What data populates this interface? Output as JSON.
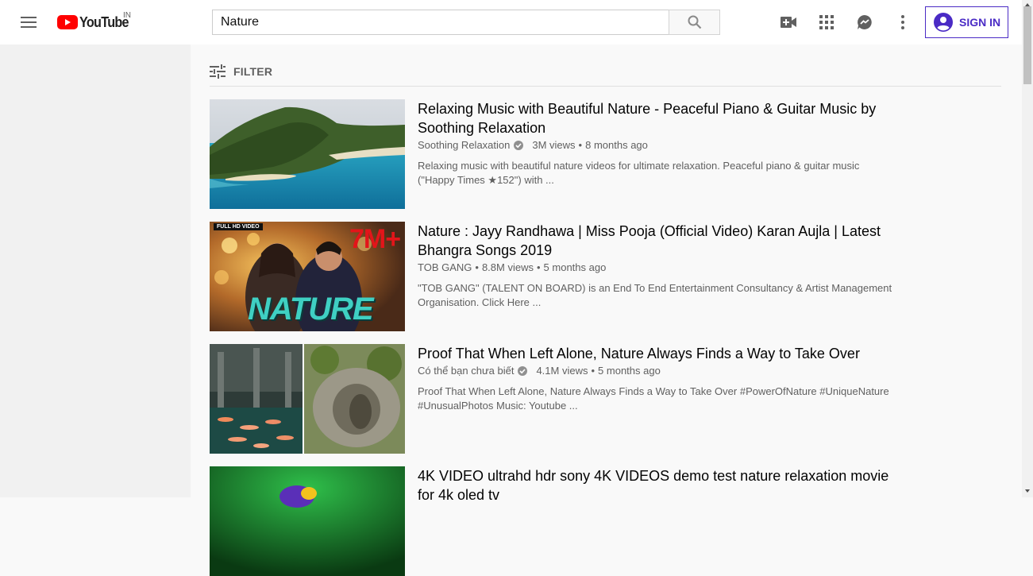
{
  "masthead": {
    "logo_text": "YouTube",
    "country_code": "IN",
    "search_value": "Nature",
    "sign_in_label": "SIGN IN",
    "accent": "#4a2bc5",
    "icons": [
      "menu-icon",
      "search-icon",
      "video-camera-icon",
      "apps-grid-icon",
      "messages-icon",
      "more-vert-icon",
      "account-icon"
    ]
  },
  "filter": {
    "label": "FILTER",
    "icon": "tune-icon"
  },
  "results": [
    {
      "title": "Relaxing Music with Beautiful Nature - Peaceful Piano & Guitar Music by Soothing Relaxation",
      "channel": "Soothing Relaxation",
      "verified": true,
      "views": "3M views",
      "age": "8 months ago",
      "description": "Relaxing music with beautiful nature videos for ultimate relaxation. Peaceful piano & guitar music (\"Happy Times ★152\") with ..."
    },
    {
      "title": "Nature : Jayy Randhawa | Miss Pooja (Official Video) Karan Aujla | Latest Bhangra Songs 2019",
      "channel": "TOB GANG",
      "verified": false,
      "views": "8.8M views",
      "age": "5 months ago",
      "description": "\"TOB GANG\" (TALENT ON BOARD) is an End To End Entertainment Consultancy & Artist Management Organisation. Click Here ...",
      "thumb_badge_top": "FULL HD VIDEO",
      "thumb_badge_count": "7M+",
      "thumb_overlay_text": "NATURE"
    },
    {
      "title": "Proof That When Left Alone, Nature Always Finds a Way to Take Over",
      "channel": "Có thể bạn chưa biết",
      "verified": true,
      "views": "4.1M views",
      "age": "5 months ago",
      "description": "Proof That When Left Alone, Nature Always Finds a Way to Take Over #PowerOfNature #UniqueNature #UnusualPhotos Music: Youtube ..."
    },
    {
      "title": "4K VIDEO ultrahd hdr sony 4K VIDEOS demo test nature relaxation movie for 4k oled tv",
      "channel": "",
      "verified": false,
      "views": "",
      "age": "",
      "description": ""
    }
  ]
}
